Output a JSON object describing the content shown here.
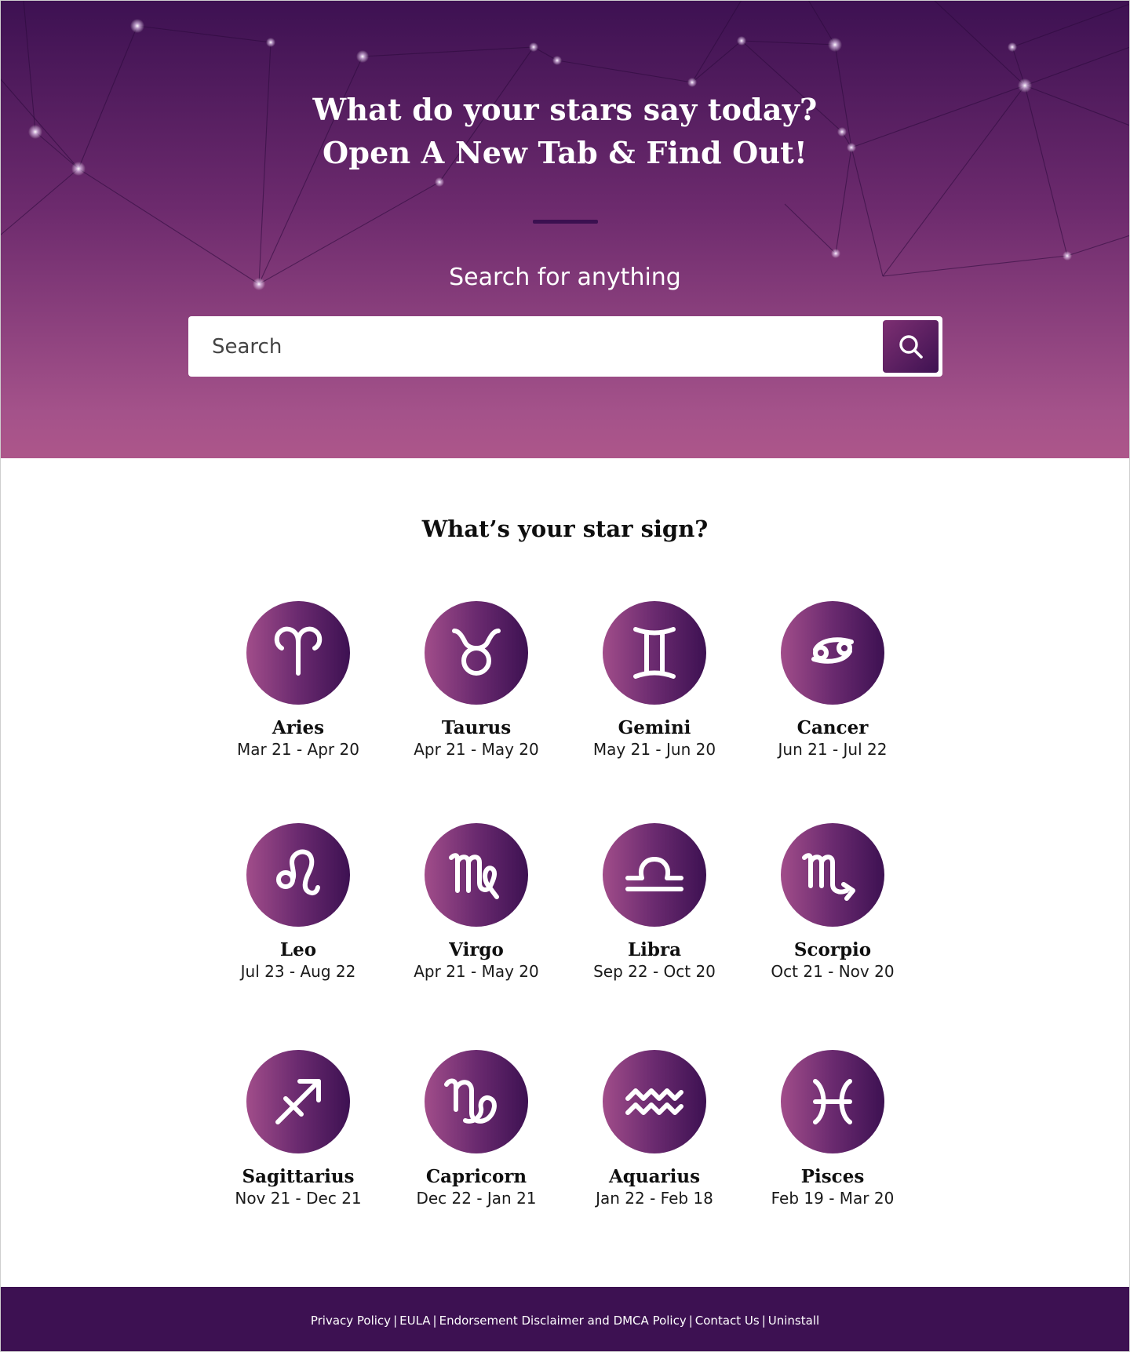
{
  "hero": {
    "title_line1": "What do your stars say today?",
    "title_line2": "Open A New Tab & Find Out!",
    "search_heading": "Search for anything",
    "search_placeholder": "Search"
  },
  "signs_section": {
    "heading": "What’s your star sign?"
  },
  "signs": [
    {
      "name": "Aries",
      "dates": "Mar 21 - Apr 20",
      "icon": "aries-icon"
    },
    {
      "name": "Taurus",
      "dates": "Apr 21 - May 20",
      "icon": "taurus-icon"
    },
    {
      "name": "Gemini",
      "dates": "May 21 - Jun 20",
      "icon": "gemini-icon"
    },
    {
      "name": "Cancer",
      "dates": "Jun 21 - Jul 22",
      "icon": "cancer-icon"
    },
    {
      "name": "Leo",
      "dates": "Jul 23 - Aug 22",
      "icon": "leo-icon"
    },
    {
      "name": "Virgo",
      "dates": "Apr 21 - May 20",
      "icon": "virgo-icon"
    },
    {
      "name": "Libra",
      "dates": "Sep 22 - Oct 20",
      "icon": "libra-icon"
    },
    {
      "name": "Scorpio",
      "dates": "Oct 21 - Nov 20",
      "icon": "scorpio-icon"
    },
    {
      "name": "Sagittarius",
      "dates": "Nov 21 - Dec 21",
      "icon": "sagittarius-icon"
    },
    {
      "name": "Capricorn",
      "dates": "Dec 22 - Jan 21",
      "icon": "capricorn-icon"
    },
    {
      "name": "Aquarius",
      "dates": "Jan 22 - Feb 18",
      "icon": "aquarius-icon"
    },
    {
      "name": "Pisces",
      "dates": "Feb 19 - Mar 20",
      "icon": "pisces-icon"
    }
  ],
  "footer": {
    "links": [
      "Privacy Policy",
      "EULA",
      "Endorsement Disclaimer and DMCA Policy",
      "Contact Us",
      "Uninstall"
    ],
    "separator": "|"
  },
  "colors": {
    "hero_top": "#3d1152",
    "hero_bottom": "#ad568a",
    "footer": "#3d1152",
    "icon_circle_light": "#a14d8a",
    "icon_circle_dark": "#3d1152"
  }
}
